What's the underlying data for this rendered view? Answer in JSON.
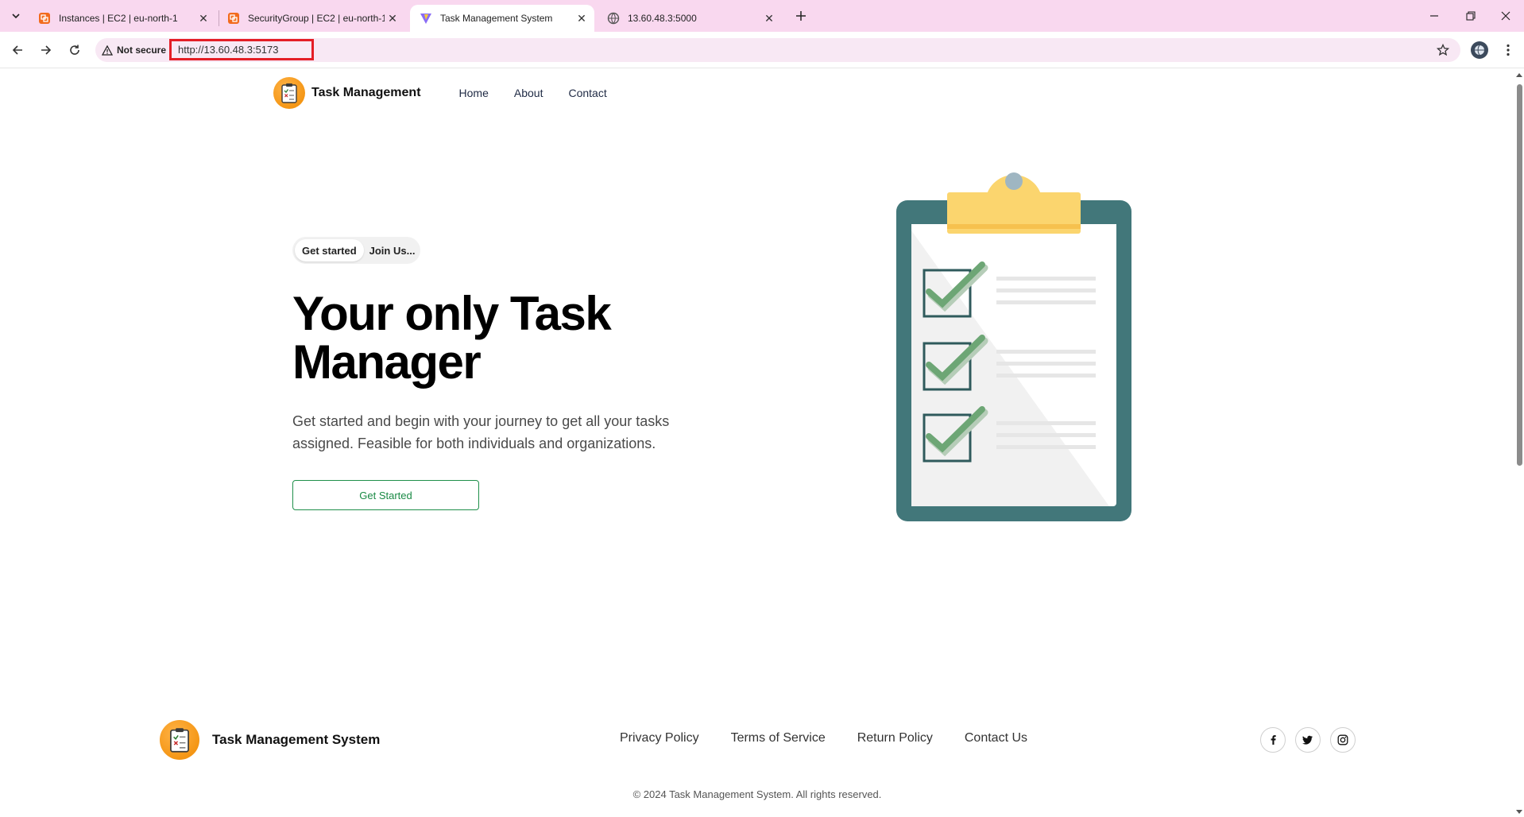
{
  "browser": {
    "tabs": [
      {
        "title": "Instances | EC2 | eu-north-1",
        "favicon": "aws-icon"
      },
      {
        "title": "SecurityGroup | EC2 | eu-north-1",
        "favicon": "aws-icon"
      },
      {
        "title": "Task Management System",
        "favicon": "vite-icon",
        "active": true
      },
      {
        "title": "13.60.48.3:5000",
        "favicon": "globe-icon"
      }
    ],
    "security_label": "Not secure",
    "url": "http://13.60.48.3:5173"
  },
  "nav": {
    "brand": "Task Management",
    "links": [
      "Home",
      "About",
      "Contact"
    ]
  },
  "hero": {
    "pill_primary": "Get started",
    "pill_secondary": "Join Us...",
    "title": "Your only Task Manager",
    "subtitle": "Get started and begin with your journey to get all your tasks assigned. Feasible for both individuals and organizations.",
    "cta": "Get Started"
  },
  "footer": {
    "brand": "Task Management System",
    "links": [
      "Privacy Policy",
      "Terms of Service",
      "Return Policy",
      "Contact Us"
    ],
    "social": [
      "facebook-icon",
      "twitter-icon",
      "instagram-icon"
    ],
    "copyright": "© 2024 Task Management System. All rights reserved."
  },
  "colors": {
    "tabbar": "#f9d8ef",
    "accent_green": "#1a8a45",
    "clipboard_board": "#42777a",
    "clipboard_clip": "#fbd56e",
    "logo_orange": "#f39a12"
  }
}
